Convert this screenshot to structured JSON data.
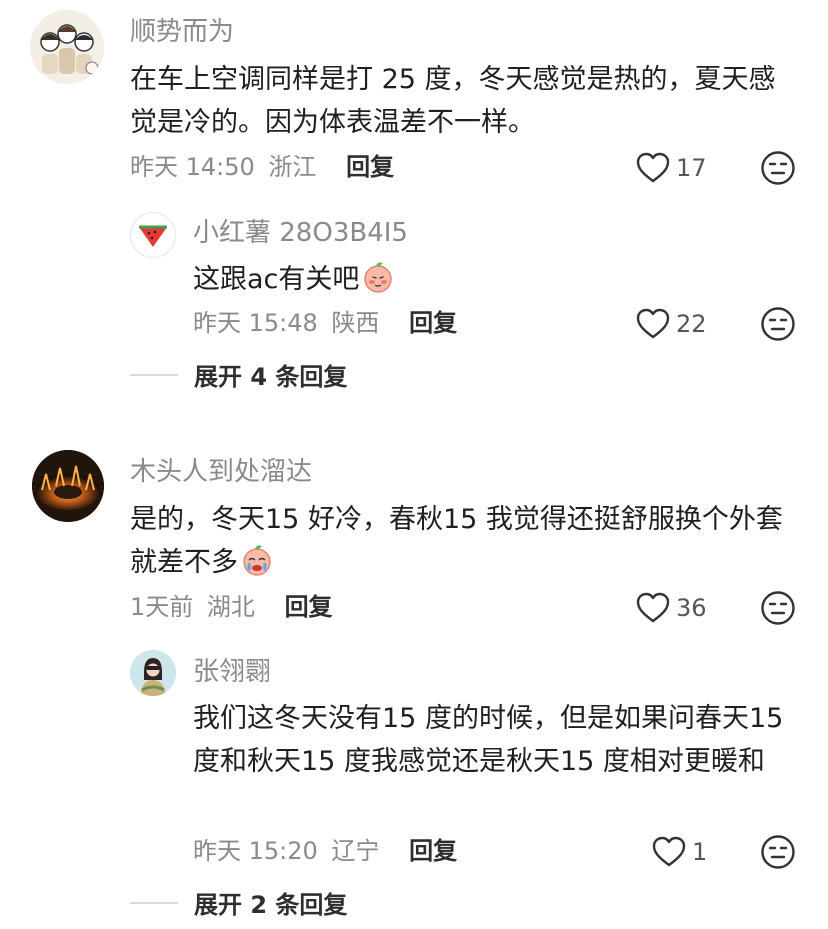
{
  "comments": [
    {
      "name": "顺势而为",
      "text": "在车上空调同样是打 25 度，冬天感觉是热的，夏天感觉是冷的。因为体表温差不一样。",
      "time": "昨天 14:50",
      "location": "浙江",
      "reply_label": "回复",
      "likes": "17",
      "replies": [
        {
          "name": "小红薯 28O3B4I5",
          "text": "这跟ac有关吧",
          "time": "昨天 15:48",
          "location": "陕西",
          "reply_label": "回复",
          "likes": "22"
        }
      ],
      "expand_label": "展开 4 条回复"
    },
    {
      "name": "木头人到处溜达",
      "text": "是的，冬天15 好冷，春秋15 我觉得还挺舒服换个外套就差不多",
      "time": "1天前",
      "location": "湖北",
      "reply_label": "回复",
      "likes": "36",
      "replies": [
        {
          "name": "张翎翾",
          "text": "我们这冬天没有15 度的时候，但是如果问春天15 度和秋天15 度我感觉还是秋天15 度相对更暖和",
          "time": "昨天 15:20",
          "location": "辽宁",
          "reply_label": "回复",
          "likes": "1"
        }
      ],
      "expand_label": "展开 2 条回复"
    }
  ],
  "icons": {
    "like": "heart-outline-icon",
    "dislike": "neutral-face-icon",
    "emoji_shy": "peach-shy-emoji",
    "emoji_cry": "peach-cry-emoji"
  },
  "colors": {
    "meta_gray": "#8a8a8a",
    "text": "#1f1f1f"
  }
}
